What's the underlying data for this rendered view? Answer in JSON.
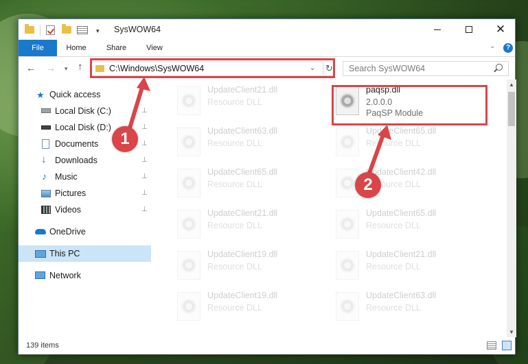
{
  "window": {
    "title": "SysWOW64",
    "minimize_icon": "minimize-icon",
    "maximize_icon": "maximize-icon",
    "close_icon": "close-icon",
    "close_glyph": "✕"
  },
  "quick_access_toolbar": {
    "dropdown_glyph": "▾",
    "icons": [
      "folder-icon",
      "properties-check-icon",
      "new-folder-icon",
      "customize-icon"
    ]
  },
  "ribbon": {
    "tabs": [
      "File",
      "Home",
      "Share",
      "View"
    ],
    "collapse_glyph": "⌄",
    "help_glyph": "?"
  },
  "navbar": {
    "back_glyph": "←",
    "forward_glyph": "→",
    "recent_glyph": "▾",
    "up_glyph": "↑",
    "address": "C:\\Windows\\SysWOW64",
    "address_dropdown_glyph": "⌄",
    "refresh_glyph": "↻",
    "search_placeholder": "Search SysWOW64"
  },
  "sidebar": {
    "items": [
      {
        "label": "Quick access",
        "icon": "star-icon",
        "pinned": false
      },
      {
        "label": "Local Disk (C:)",
        "icon": "drive-icon",
        "pinned": true
      },
      {
        "label": "Local Disk (D:)",
        "icon": "drive-icon",
        "pinned": true
      },
      {
        "label": "Documents",
        "icon": "documents-icon",
        "pinned": true
      },
      {
        "label": "Downloads",
        "icon": "download-icon",
        "pinned": true
      },
      {
        "label": "Music",
        "icon": "music-icon",
        "pinned": true
      },
      {
        "label": "Pictures",
        "icon": "pictures-icon",
        "pinned": true
      },
      {
        "label": "Videos",
        "icon": "videos-icon",
        "pinned": true
      },
      {
        "label": "OneDrive",
        "icon": "cloud-icon",
        "pinned": false
      },
      {
        "label": "This PC",
        "icon": "computer-icon",
        "pinned": false,
        "selected": true
      },
      {
        "label": "Network",
        "icon": "network-icon",
        "pinned": false
      }
    ],
    "pin_glyph": "📌"
  },
  "files": {
    "left_column": [
      {
        "name": "UpdateClient21.dll",
        "type": "Resource DLL"
      },
      {
        "name": "UpdateClient63.dll",
        "type": "Resource DLL"
      },
      {
        "name": "UpdateClient65.dll",
        "type": "Resource DLL"
      },
      {
        "name": "UpdateClient21.dll",
        "type": "Resource DLL"
      },
      {
        "name": "UpdateClient19.dll",
        "type": "Resource DLL"
      },
      {
        "name": "UpdateClient19.dll",
        "type": "Resource DLL"
      }
    ],
    "right_column": [
      {
        "name": "paqsp.dll",
        "version": "2.0.0.0",
        "description": "PaqSP Module",
        "highlighted": true
      },
      {
        "name": "UpdateClient65.dll",
        "type": "Resource DLL"
      },
      {
        "name": "UpdateClient42.dll",
        "type": "Resource DLL"
      },
      {
        "name": "UpdateClient65.dll",
        "type": "Resource DLL"
      },
      {
        "name": "UpdateClient21.dll",
        "type": "Resource DLL"
      },
      {
        "name": "UpdateClient63.dll",
        "type": "Resource DLL"
      }
    ]
  },
  "scrollbar": {
    "up_glyph": "▲",
    "down_glyph": "▼"
  },
  "status": {
    "item_count": "139 items"
  },
  "annotations": {
    "marker_1": "1",
    "marker_2": "2",
    "color": "#d94548"
  }
}
